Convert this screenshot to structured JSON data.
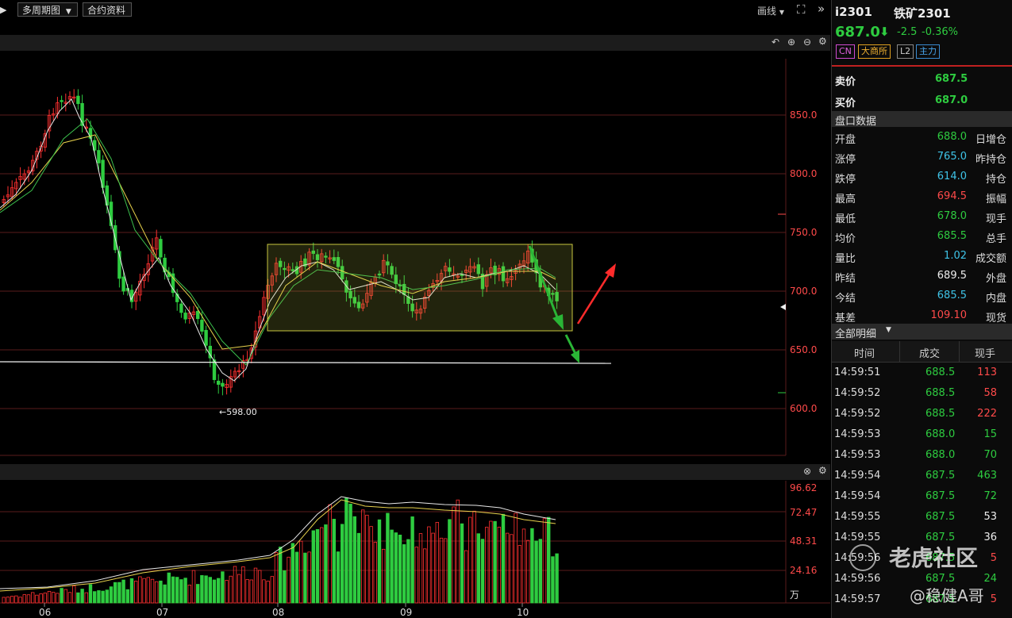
{
  "toolbar": {
    "period_label": "多周期图",
    "contract_label": "合约资料",
    "draw_label": "画线"
  },
  "price_axis": [
    "850.0",
    "800.0",
    "750.0",
    "700.0",
    "650.0",
    "600.0"
  ],
  "low_marker": "598.00",
  "volume_axis": [
    "96.62",
    "72.47",
    "48.31",
    "24.16",
    "万"
  ],
  "time_axis": [
    "06",
    "07",
    "08",
    "09",
    "10"
  ],
  "header": {
    "code": "i2301",
    "name": "铁矿2301",
    "price": "687.0",
    "change": "-2.5",
    "change_pct": "-0.36%",
    "tags": [
      "CN",
      "大商所",
      "L2",
      "主力"
    ]
  },
  "quote": {
    "ask_label": "卖价",
    "ask": "687.5",
    "bid_label": "买价",
    "bid": "687.0"
  },
  "panel_title": "盘口数据",
  "stats": [
    {
      "label": "开盘",
      "value": "688.0",
      "color": "green",
      "label2": "日增仓"
    },
    {
      "label": "涨停",
      "value": "765.0",
      "color": "cyan",
      "label2": "昨持仓"
    },
    {
      "label": "跌停",
      "value": "614.0",
      "color": "cyan",
      "label2": "持仓"
    },
    {
      "label": "最高",
      "value": "694.5",
      "color": "red",
      "label2": "振幅"
    },
    {
      "label": "最低",
      "value": "678.0",
      "color": "green",
      "label2": "现手"
    },
    {
      "label": "均价",
      "value": "685.5",
      "color": "green",
      "label2": "总手"
    },
    {
      "label": "量比",
      "value": "1.02",
      "color": "cyan",
      "label2": "成交额"
    },
    {
      "label": "昨结",
      "value": "689.5",
      "color": "white",
      "label2": "外盘"
    },
    {
      "label": "今结",
      "value": "685.5",
      "color": "cyan",
      "label2": "内盘"
    },
    {
      "label": "基差",
      "value": "109.10",
      "color": "red",
      "label2": "现货"
    }
  ],
  "details_title": "全部明细",
  "details_headers": [
    "时间",
    "成交",
    "现手"
  ],
  "ticks": [
    {
      "time": "14:59:51",
      "price": "688.5",
      "vol": "113",
      "vcolor": "red"
    },
    {
      "time": "14:59:52",
      "price": "688.5",
      "vol": "58",
      "vcolor": "red"
    },
    {
      "time": "14:59:52",
      "price": "688.5",
      "vol": "222",
      "vcolor": "red"
    },
    {
      "time": "14:59:53",
      "price": "688.0",
      "vol": "15",
      "vcolor": "green"
    },
    {
      "time": "14:59:53",
      "price": "688.0",
      "vol": "70",
      "vcolor": "green"
    },
    {
      "time": "14:59:54",
      "price": "687.5",
      "vol": "463",
      "vcolor": "green"
    },
    {
      "time": "14:59:54",
      "price": "687.5",
      "vol": "72",
      "vcolor": "green"
    },
    {
      "time": "14:59:55",
      "price": "687.5",
      "vol": "53",
      "vcolor": "white"
    },
    {
      "time": "14:59:55",
      "price": "687.5",
      "vol": "36",
      "vcolor": "white"
    },
    {
      "time": "14:59:56",
      "price": "687.5",
      "vol": "5",
      "vcolor": "red"
    },
    {
      "time": "14:59:56",
      "price": "687.5",
      "vol": "24",
      "vcolor": "green"
    },
    {
      "time": "14:59:57",
      "price": "687.5",
      "vol": "5",
      "vcolor": "red"
    }
  ],
  "watermark": {
    "logo": "老虎社区",
    "author": "@稳健A哥"
  }
}
